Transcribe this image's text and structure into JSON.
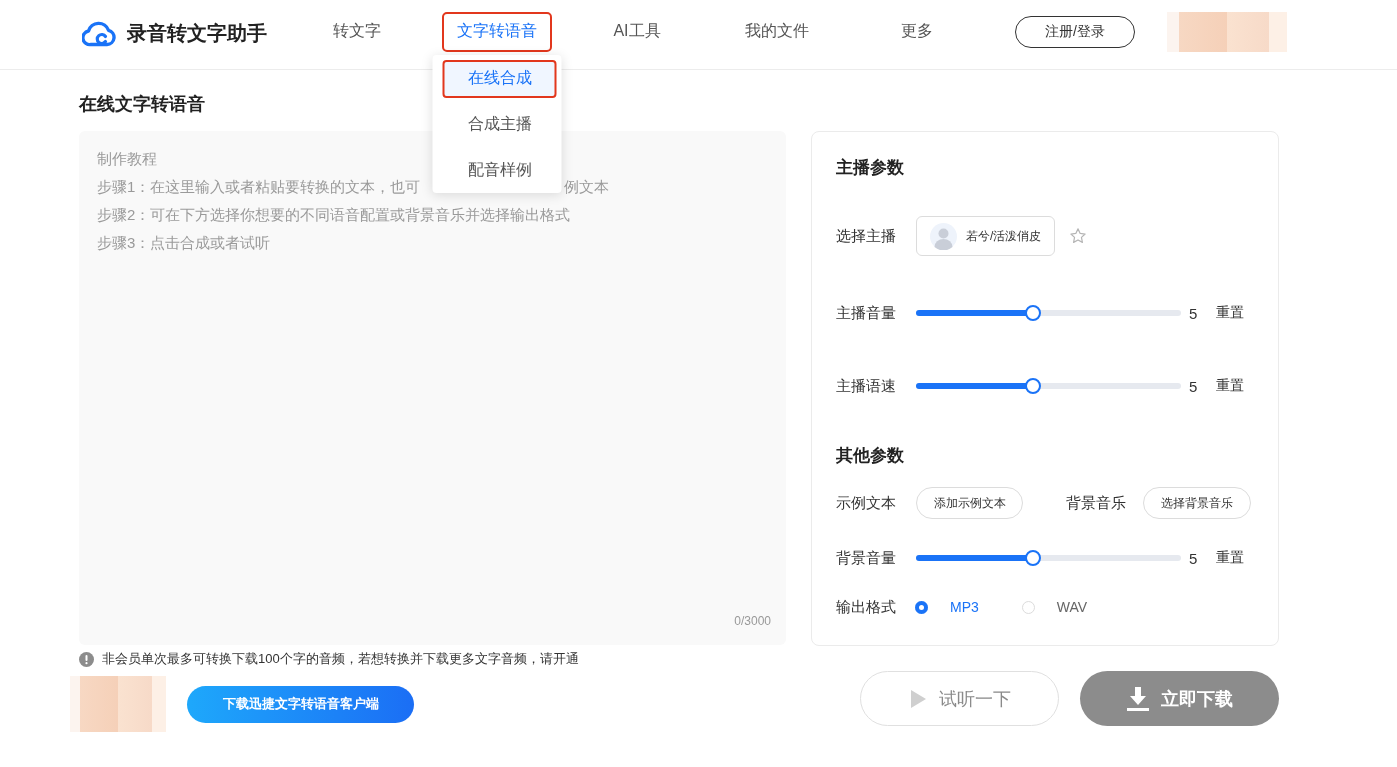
{
  "header": {
    "logo": "录音转文字助手",
    "nav": [
      {
        "label": "转文字",
        "selected": false,
        "highlighted": false
      },
      {
        "label": "文字转语音",
        "selected": true,
        "highlighted": true,
        "expanded": true,
        "menu": [
          {
            "label": "在线合成",
            "selected": true,
            "highlighted": true
          },
          {
            "label": "合成主播",
            "selected": false,
            "highlighted": false
          },
          {
            "label": "配音样例",
            "selected": false,
            "highlighted": false
          }
        ]
      },
      {
        "label": "AI工具",
        "selected": false,
        "highlighted": false
      },
      {
        "label": "我的文件",
        "selected": false,
        "highlighted": false
      },
      {
        "label": "更多",
        "selected": false,
        "highlighted": false
      }
    ],
    "login_button": "注册/登录"
  },
  "page_title": "在线文字转语音",
  "editor": {
    "placeholder_lines": [
      [
        "制作教程"
      ],
      [
        "步骤1：在这里输入或者粘贴要转换的文本，也可",
        "例文本"
      ],
      [
        "步骤2：可在下方选择你想要的不同语音配置或背景音乐并选择输出格式"
      ],
      [
        "步骤3：点击合成或者试听"
      ]
    ],
    "counter": "0/3000"
  },
  "notice": "非会员单次最多可转换下载100个字的音频，若想转换并下载更多文字音频，请开通",
  "client_download_button": "下载迅捷文字转语音客户端",
  "anchor_params": {
    "title": "主播参数",
    "anchor": {
      "label": "选择主播",
      "name": "若兮/活泼俏皮",
      "favorite": false
    },
    "sliders": [
      {
        "label": "主播音量",
        "level": 0.44,
        "reading": "5",
        "reset": "重置"
      },
      {
        "label": "主播语速",
        "level": 0.44,
        "reading": "5",
        "reset": "重置"
      }
    ]
  },
  "other_params": {
    "title": "其他参数",
    "sample_text": {
      "label": "示例文本",
      "button": "添加示例文本"
    },
    "background_music": {
      "label": "背景音乐",
      "button": "选择背景音乐"
    },
    "sliders": [
      {
        "label": "背景音量",
        "level": 0.44,
        "reading": "5",
        "reset": "重置"
      }
    ],
    "output_format": {
      "label": "输出格式",
      "options": [
        {
          "label": "MP3",
          "selected": true
        },
        {
          "label": "WAV",
          "selected": false
        }
      ]
    }
  },
  "actions": [
    {
      "kind": "preview",
      "label": "试听一下",
      "disabled": true
    },
    {
      "kind": "download",
      "label": "立即下载",
      "disabled": true
    }
  ]
}
